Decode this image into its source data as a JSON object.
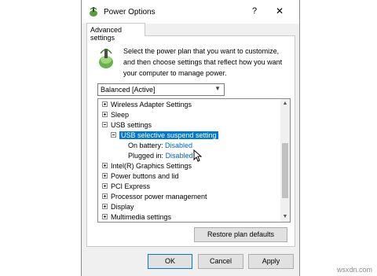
{
  "window": {
    "title": "Power Options",
    "help_glyph": "?",
    "close_glyph": "✕"
  },
  "tab": {
    "label": "Advanced settings"
  },
  "intro": {
    "text": "Select the power plan that you want to customize, and then choose settings that reflect how you want your computer to manage power."
  },
  "plan_select": {
    "value": "Balanced [Active]"
  },
  "tree": {
    "items": [
      {
        "label": "Wireless Adapter Settings",
        "state": "collapsed"
      },
      {
        "label": "Sleep",
        "state": "collapsed"
      },
      {
        "label": "USB settings",
        "state": "expanded"
      },
      {
        "label": "USB selective suspend setting",
        "state": "expanded",
        "selected": true
      },
      {
        "label": "On battery:",
        "value": "Disabled"
      },
      {
        "label": "Plugged in:",
        "value": "Disabled"
      },
      {
        "label": "Intel(R) Graphics Settings",
        "state": "collapsed"
      },
      {
        "label": "Power buttons and lid",
        "state": "collapsed"
      },
      {
        "label": "PCI Express",
        "state": "collapsed"
      },
      {
        "label": "Processor power management",
        "state": "collapsed"
      },
      {
        "label": "Display",
        "state": "collapsed"
      },
      {
        "label": "Multimedia settings",
        "state": "collapsed"
      }
    ]
  },
  "buttons": {
    "restore": "Restore plan defaults",
    "ok": "OK",
    "cancel": "Cancel",
    "apply": "Apply"
  },
  "watermark": "wsxdn.com",
  "colors": {
    "selection": "#0078d7",
    "link": "#0066cc",
    "primary_border": "#0078d7"
  },
  "icons": {
    "app": "power-options-icon",
    "cursor": "mouse-pointer-icon"
  }
}
